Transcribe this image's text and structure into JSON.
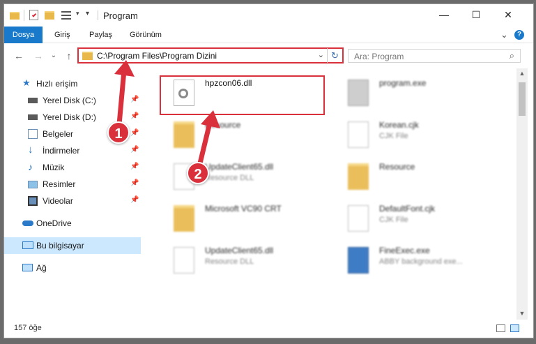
{
  "window": {
    "title": "Program",
    "controls": {
      "minimize": "—",
      "maximize": "☐",
      "close": "✕"
    }
  },
  "ribbon": {
    "tabs": [
      "Dosya",
      "Giriş",
      "Paylaş",
      "Görünüm"
    ],
    "expand": "⌄",
    "help": "?"
  },
  "navbar": {
    "back": "←",
    "forward": "→",
    "recent": "⌄",
    "up": "↑",
    "address": "C:\\Program Files\\Program Dizini",
    "address_dropdown": "⌄",
    "refresh": "↻",
    "search_placeholder": "Ara: Program",
    "search_icon": "⌕"
  },
  "sidebar": {
    "items": [
      {
        "label": "Hızlı erişim",
        "icon": "star-icon",
        "pinned": false
      },
      {
        "label": "Yerel Disk (C:)",
        "icon": "drive-icon",
        "pinned": true
      },
      {
        "label": "Yerel Disk (D:)",
        "icon": "drive-icon",
        "pinned": true
      },
      {
        "label": "Belgeler",
        "icon": "documents-icon",
        "pinned": true
      },
      {
        "label": "İndirmeler",
        "icon": "download-icon",
        "pinned": true
      },
      {
        "label": "Müzik",
        "icon": "music-icon",
        "pinned": true
      },
      {
        "label": "Resimler",
        "icon": "pictures-icon",
        "pinned": true
      },
      {
        "label": "Videolar",
        "icon": "videos-icon",
        "pinned": true
      },
      {
        "label": "OneDrive",
        "icon": "cloud-icon",
        "pinned": false
      },
      {
        "label": "Bu bilgisayar",
        "icon": "computer-icon",
        "pinned": false,
        "selected": true
      },
      {
        "label": "Ağ",
        "icon": "network-icon",
        "pinned": false
      }
    ],
    "pin_glyph": "📌"
  },
  "files": [
    {
      "name": "hpzcon06.dll",
      "type": "",
      "icon": "gear-file-icon",
      "highlighted": true
    },
    {
      "name": "program.exe",
      "type": "",
      "icon": "exe-icon"
    },
    {
      "name": "Resource",
      "type": "",
      "icon": "folder-icon"
    },
    {
      "name": "Korean.cjk",
      "type": "CJK File",
      "icon": "document-icon"
    },
    {
      "name": "UpdateClient65.dll",
      "type": "Resource DLL",
      "icon": "gear-file-icon"
    },
    {
      "name": "Resource",
      "type": "",
      "icon": "folder-icon"
    },
    {
      "name": "Microsoft VC90 CRT",
      "type": "",
      "icon": "folder-icon"
    },
    {
      "name": "DefaultFont.cjk",
      "type": "CJK File",
      "icon": "document-icon"
    },
    {
      "name": "UpdateClient65.dll",
      "type": "Resource DLL",
      "icon": "gear-file-icon"
    },
    {
      "name": "FineExec.exe",
      "type": "ABBY background exe...",
      "icon": "exe-icon"
    }
  ],
  "status": {
    "item_count": "157 öğe"
  },
  "annotations": {
    "step1": "1",
    "step2": "2"
  },
  "colors": {
    "accent": "#1979ca",
    "highlight": "#d9303c",
    "selected": "#cce8ff"
  }
}
